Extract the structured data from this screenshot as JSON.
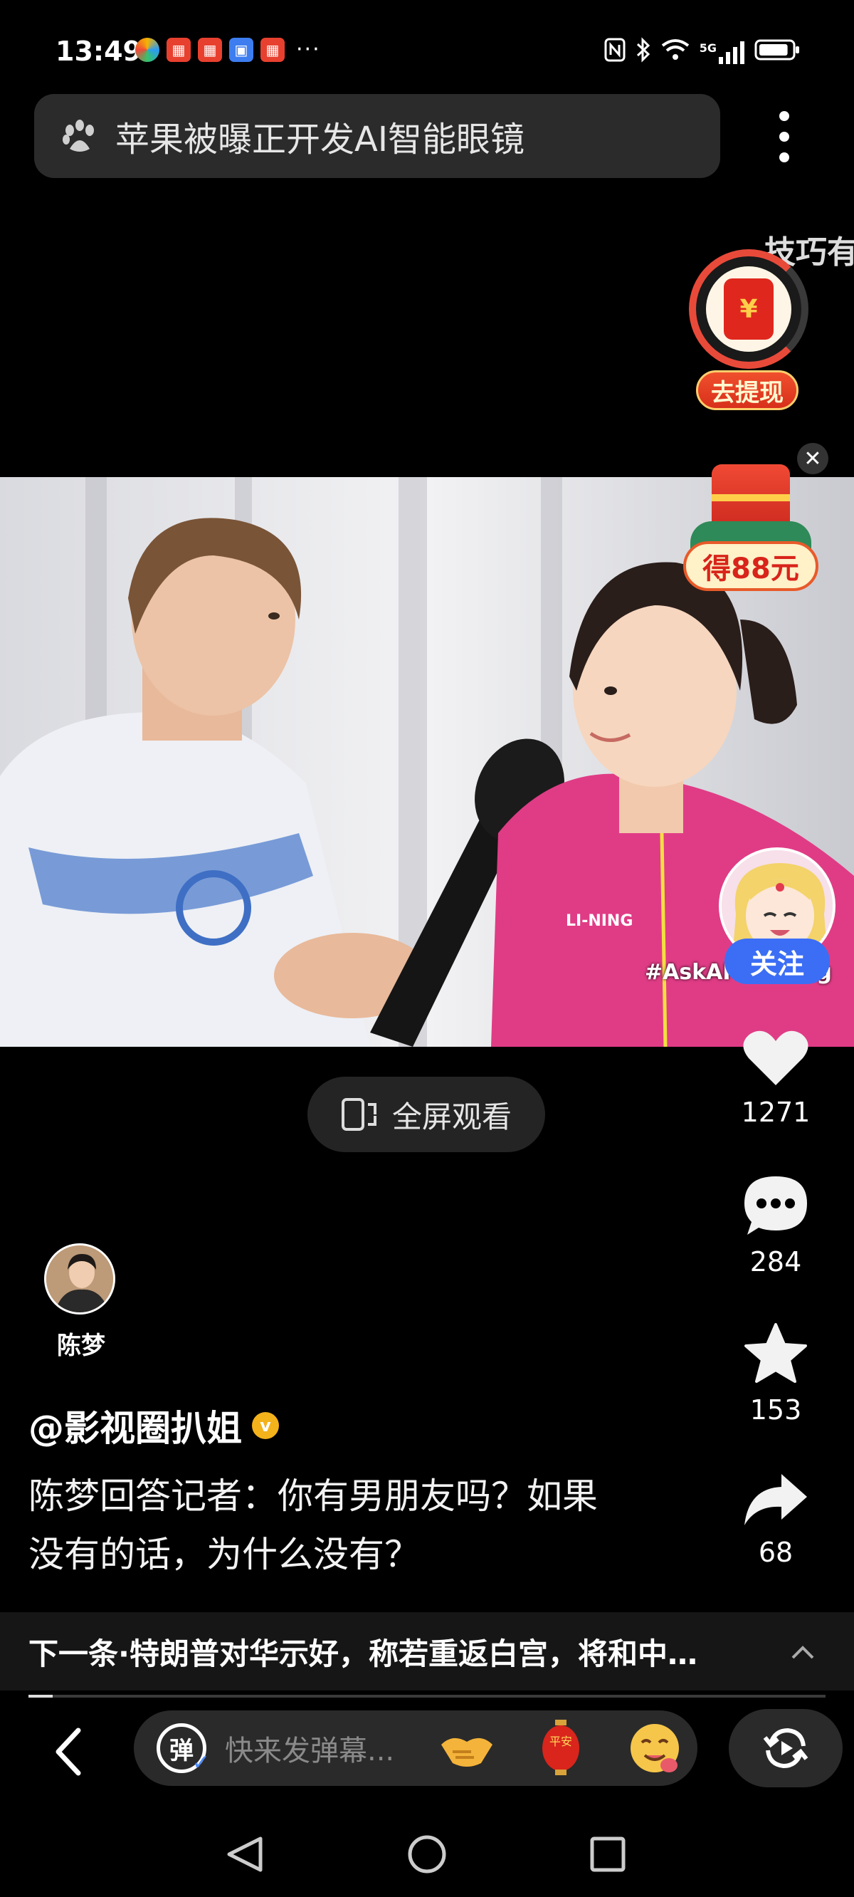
{
  "status_bar": {
    "time": "13:49",
    "more": "···",
    "network": "5G",
    "battery_percent": 90
  },
  "search": {
    "query": "苹果被曝正开发AI智能眼镜"
  },
  "floating": {
    "marquee": "技巧有",
    "redpacket_label": "去提现",
    "yuan_symbol": "¥",
    "gift_label": "得88元"
  },
  "video": {
    "watermark": "#AskAP",
    "watermark_tail": "g"
  },
  "follow": {
    "label": "关注"
  },
  "fullscreen": {
    "label": "全屏观看"
  },
  "actions": {
    "likes": "1271",
    "comments": "284",
    "favorites": "153",
    "shares": "68"
  },
  "author": {
    "name": "陈梦",
    "handle": "@影视圈扒姐",
    "verified": true
  },
  "caption": {
    "line1": "陈梦回答记者：你有男朋友吗？如果",
    "line2": "没有的话，为什么没有？"
  },
  "next": {
    "text": "下一条·特朗普对华示好，称若重返白宫，将和中…"
  },
  "playback_progress": 0.03,
  "bottom": {
    "danmaku_icon": "弹",
    "danmaku_placeholder": "快来发弹幕...",
    "emojis": [
      "handshake-emoji",
      "pingan-lantern-emoji",
      "yummy-face-emoji"
    ],
    "lantern_text": "平安"
  },
  "colors": {
    "follow_blue": "#3b6ef5",
    "redpacket_red": "#e0271e",
    "verify_gold": "#f4b21b"
  }
}
